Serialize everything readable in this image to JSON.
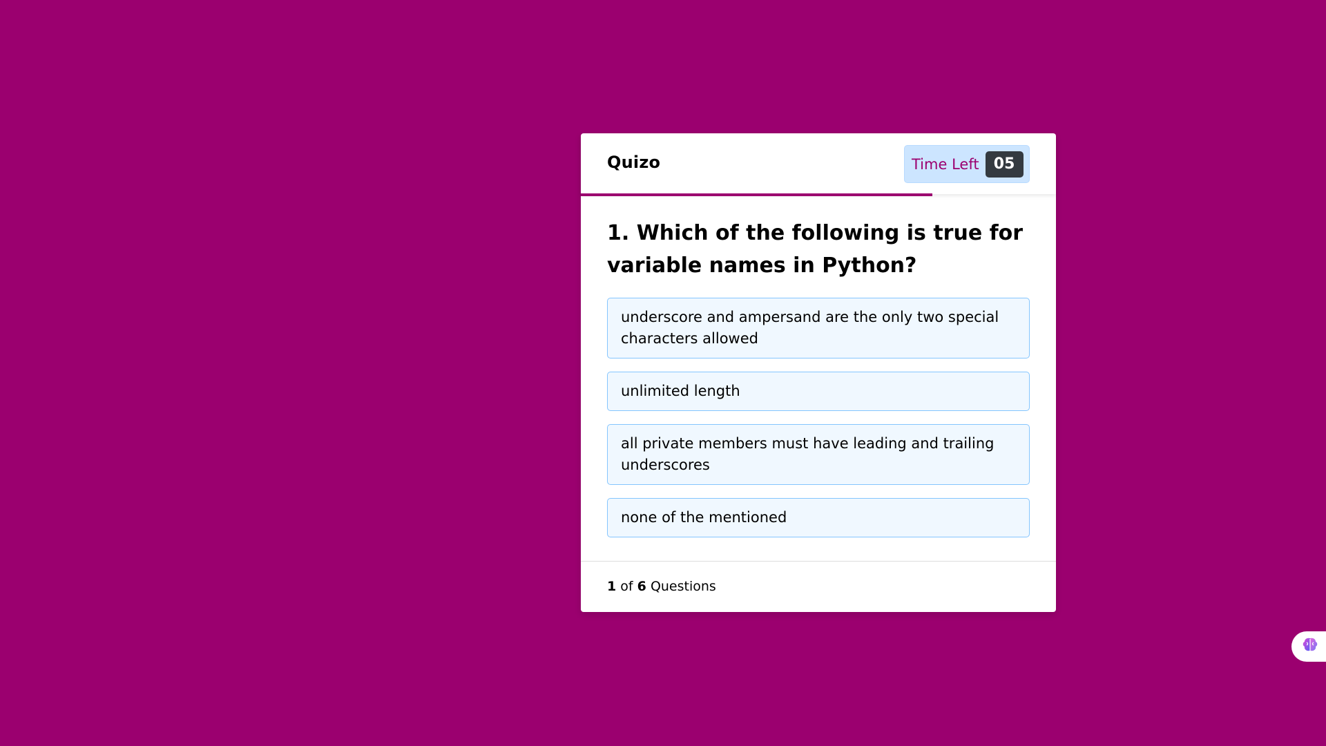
{
  "app": {
    "title": "Quizo"
  },
  "timer": {
    "label": "Time Left",
    "value": "05",
    "progress_fraction": 0.74
  },
  "question": {
    "text": "1. Which of the following is true for variable names in Python?",
    "options": [
      "underscore and ampersand are the only two special characters allowed",
      "unlimited length",
      "all private members must have leading and trailing underscores",
      "none of the mentioned"
    ]
  },
  "footer": {
    "current": "1",
    "of_text": "of",
    "total": "6",
    "suffix": "Questions"
  },
  "widget": {
    "icon": "brain-icon"
  },
  "colors": {
    "background": "#9b006f",
    "accent": "#9b006f",
    "timer_bg": "#cce5ff",
    "option_bg": "#f0f8ff",
    "option_border": "#84c5fe",
    "counter_bg": "#343a40"
  }
}
